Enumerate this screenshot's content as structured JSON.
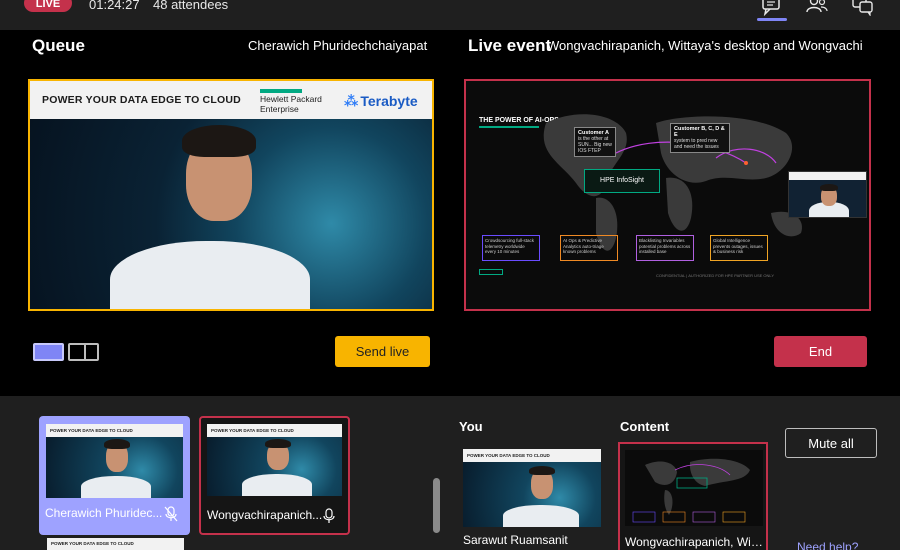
{
  "topbar": {
    "live_badge": "LIVE",
    "timer": "01:24:27",
    "attendees": "48 attendees",
    "icons": [
      "chat-icon",
      "people-icon",
      "qna-icon"
    ]
  },
  "stage": {
    "queue_title": "Queue",
    "queue_presenter": "Cherawich Phuridechchaiyapat",
    "live_title": "Live event",
    "live_presenter": "Wongvachirapanich, Wittaya's desktop and Wongvachi",
    "send_live_label": "Send live",
    "end_label": "End"
  },
  "banner": {
    "headline": "POWER YOUR DATA EDGE TO CLOUD",
    "hpe_line1": "Hewlett Packard",
    "hpe_line2": "Enterprise",
    "terabyte": "Terabyte"
  },
  "slide": {
    "title": "THE POWER OF AI-OPS",
    "customer_a": "Customer A",
    "customer_a_text": "is the other at SUN... Big new IOS FTEP",
    "customer_bcde": "Customer B, C, D & E",
    "customer_bcde_text": "system to pred new and need the issues",
    "hpe_insight": "HPE InfoSight",
    "box1": "Crowdsourcing full-stack telemetry worldwide every 10 minutes",
    "box2": "AI Ops & Predictive Analytics auto-triage known problems",
    "box3": "Blacklisting Invariables potential problems across installed base",
    "box4": "Global Intelligence prevents outages, issues & business risk",
    "footer": "CONFIDENTIAL | AUTHORIZED FOR HPE PARTNER USE ONLY"
  },
  "bottom": {
    "tile1_name": "Cherawich Phuridec...",
    "tile2_name": "Wongvachirapanich...",
    "you_label": "You",
    "you_name": "Sarawut Ruamsanit",
    "content_label": "Content",
    "content_name": "Wongvachirapanich, Witt...",
    "mute_all_label": "Mute all",
    "need_help": "Need help?"
  },
  "colors": {
    "live_red": "#c4314b",
    "queue_yellow": "#f8b400",
    "accent_purple": "#7f85f5",
    "hpe_green": "#01a982"
  }
}
